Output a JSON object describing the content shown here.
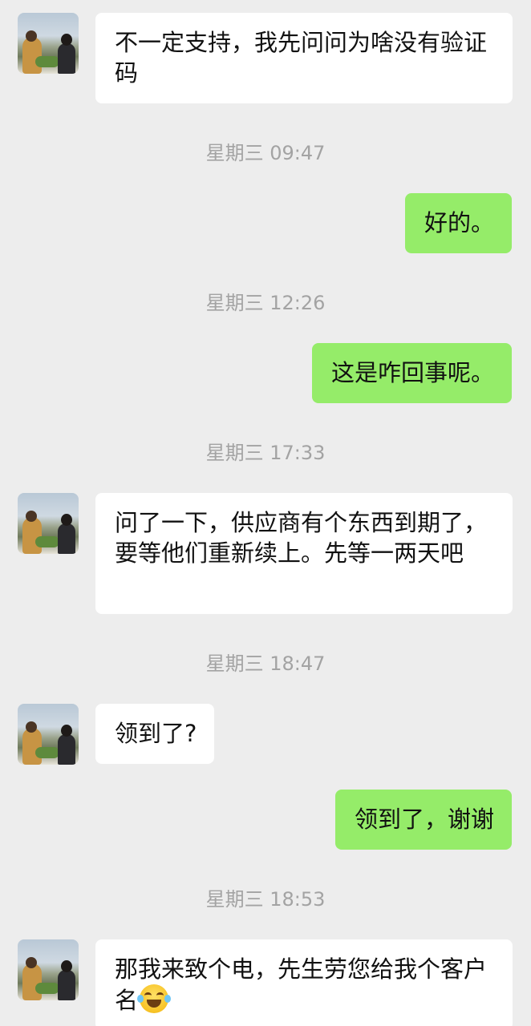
{
  "app": "WeChat chat",
  "messages": [
    {
      "type": "message",
      "side": "left",
      "text": "不一定支持，我先问问为啥没有验证码"
    },
    {
      "type": "timestamp",
      "text": "星期三 09:47"
    },
    {
      "type": "message",
      "side": "right",
      "text": "好的。"
    },
    {
      "type": "timestamp",
      "text": "星期三 12:26"
    },
    {
      "type": "message",
      "side": "right",
      "text": "这是咋回事呢。"
    },
    {
      "type": "timestamp",
      "text": "星期三 17:33"
    },
    {
      "type": "message",
      "side": "left",
      "text": "问了一下，供应商有个东西到期了，要等他们重新续上。先等一两天吧"
    },
    {
      "type": "timestamp",
      "text": "星期三 18:47"
    },
    {
      "type": "message",
      "side": "left",
      "text": "领到了?"
    },
    {
      "type": "message",
      "side": "right",
      "text": "领到了，谢谢"
    },
    {
      "type": "timestamp",
      "text": "星期三 18:53"
    },
    {
      "type": "message",
      "side": "left",
      "text": "那我来致个电，先生劳您给我个客户名",
      "emoji": "tears-of-joy-emoji"
    }
  ],
  "colors": {
    "background": "#ededed",
    "incoming_bubble": "#ffffff",
    "outgoing_bubble": "#95ec69",
    "timestamp_text": "#a3a3a3"
  }
}
